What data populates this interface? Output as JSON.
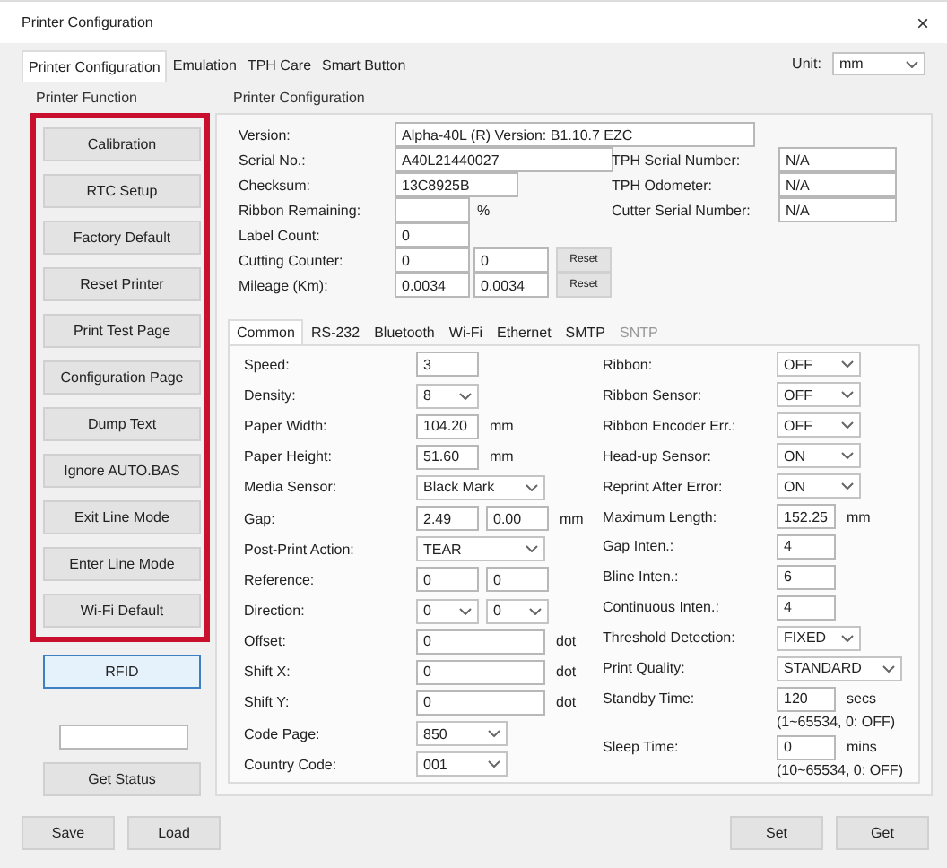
{
  "window": {
    "title": "Printer Configuration",
    "close": "×"
  },
  "tabs": [
    {
      "label": "Printer Configuration",
      "selected": true
    },
    {
      "label": "Emulation",
      "selected": false
    },
    {
      "label": "TPH Care",
      "selected": false
    },
    {
      "label": "Smart Button",
      "selected": false
    }
  ],
  "unit": {
    "label": "Unit:",
    "value": "mm"
  },
  "printer_function": {
    "title": "Printer Function",
    "highlighted_buttons": [
      {
        "label": "Calibration",
        "focused": false
      },
      {
        "label": "RTC Setup",
        "focused": false
      },
      {
        "label": "Factory Default",
        "focused": false
      },
      {
        "label": "Reset Printer",
        "focused": false
      },
      {
        "label": "Print Test Page",
        "focused": false
      },
      {
        "label": "Configuration Page",
        "focused": false
      },
      {
        "label": "Dump Text",
        "focused": false
      },
      {
        "label": "Ignore AUTO.BAS",
        "focused": false
      },
      {
        "label": "Exit Line Mode",
        "focused": false
      },
      {
        "label": "Enter Line Mode",
        "focused": false
      },
      {
        "label": "Wi-Fi Default",
        "focused": false
      }
    ],
    "buttons": [
      {
        "label": "RFID",
        "focused": true
      }
    ],
    "status_button": "Get Status"
  },
  "printer_configuration": {
    "title": "Printer Configuration",
    "rows": [
      {
        "label": "Version:",
        "fields": [
          {
            "kind": "text",
            "value": "Alpha-40L (R) Version: B1.10.7 EZC"
          }
        ]
      },
      {
        "label": "Serial No.:",
        "fields": [
          {
            "kind": "text",
            "value": "A40L21440027"
          }
        ],
        "side": {
          "label": "TPH Serial Number:",
          "value": "N/A"
        }
      },
      {
        "label": "Checksum:",
        "fields": [
          {
            "kind": "text",
            "value": "13C8925B"
          }
        ],
        "side": {
          "label": "TPH Odometer:",
          "value": "N/A"
        }
      },
      {
        "label": "Ribbon Remaining:",
        "fields": [
          {
            "kind": "text"
          }
        ],
        "unit": "%",
        "side": {
          "label": "Cutter Serial Number:",
          "value": "N/A"
        }
      },
      {
        "label": "Label Count:",
        "fields": [
          {
            "kind": "text",
            "value": "0"
          }
        ]
      },
      {
        "label": "Cutting Counter:",
        "fields": [
          {
            "kind": "text",
            "value": "0"
          },
          {
            "kind": "text",
            "value": "0"
          }
        ],
        "button": "Reset"
      },
      {
        "label": "Mileage (Km):",
        "fields": [
          {
            "kind": "text",
            "value": "0.0034"
          },
          {
            "kind": "text",
            "value": "0.0034"
          }
        ],
        "button": "Reset"
      }
    ]
  },
  "settings_tabs": [
    {
      "label": "Common",
      "selected": true,
      "disabled": false
    },
    {
      "label": "RS-232",
      "selected": false,
      "disabled": false
    },
    {
      "label": "Bluetooth",
      "selected": false,
      "disabled": false
    },
    {
      "label": "Wi-Fi",
      "selected": false,
      "disabled": false
    },
    {
      "label": "Ethernet",
      "selected": false,
      "disabled": false
    },
    {
      "label": "SMTP",
      "selected": false,
      "disabled": false
    },
    {
      "label": "SNTP",
      "selected": false,
      "disabled": true
    }
  ],
  "settings": {
    "left": [
      {
        "label": "Speed:",
        "controls": [
          {
            "kind": "text",
            "value": "3"
          }
        ]
      },
      {
        "label": "Density:",
        "controls": [
          {
            "kind": "select",
            "value": "8"
          }
        ]
      },
      {
        "label": "Paper Width:",
        "controls": [
          {
            "kind": "text",
            "value": "104.20"
          }
        ],
        "unit": "mm"
      },
      {
        "label": "Paper Height:",
        "controls": [
          {
            "kind": "text",
            "value": "51.60"
          }
        ],
        "unit": "mm"
      },
      {
        "label": "Media Sensor:",
        "controls": [
          {
            "kind": "select",
            "value": "Black Mark"
          }
        ]
      },
      {
        "label": "Gap:",
        "controls": [
          {
            "kind": "text",
            "value": "2.49"
          },
          {
            "kind": "text",
            "value": "0.00"
          }
        ],
        "unit": "mm"
      },
      {
        "label": "Post-Print Action:",
        "controls": [
          {
            "kind": "select",
            "value": "TEAR"
          }
        ]
      },
      {
        "label": "Reference:",
        "controls": [
          {
            "kind": "text",
            "value": "0"
          },
          {
            "kind": "text",
            "value": "0"
          }
        ]
      },
      {
        "label": "Direction:",
        "controls": [
          {
            "kind": "select",
            "value": "0"
          },
          {
            "kind": "select",
            "value": "0"
          }
        ]
      },
      {
        "label": "Offset:",
        "controls": [
          {
            "kind": "text",
            "value": "0"
          }
        ],
        "unit": "dot"
      },
      {
        "label": "Shift X:",
        "controls": [
          {
            "kind": "text",
            "value": "0"
          }
        ],
        "unit": "dot"
      },
      {
        "label": "Shift Y:",
        "controls": [
          {
            "kind": "text",
            "value": "0"
          }
        ],
        "unit": "dot"
      },
      {
        "label": "Code Page:",
        "controls": [
          {
            "kind": "select",
            "value": "850"
          }
        ]
      },
      {
        "label": "Country Code:",
        "controls": [
          {
            "kind": "select",
            "value": "001"
          }
        ]
      }
    ],
    "right": [
      {
        "label": "Ribbon:",
        "controls": [
          {
            "kind": "select",
            "value": "OFF"
          }
        ]
      },
      {
        "label": "Ribbon Sensor:",
        "controls": [
          {
            "kind": "select",
            "value": "OFF"
          }
        ]
      },
      {
        "label": "Ribbon Encoder Err.:",
        "controls": [
          {
            "kind": "select",
            "value": "OFF"
          }
        ]
      },
      {
        "label": "Head-up Sensor:",
        "controls": [
          {
            "kind": "select",
            "value": "ON"
          }
        ]
      },
      {
        "label": "Reprint After Error:",
        "controls": [
          {
            "kind": "select",
            "value": "ON"
          }
        ]
      },
      {
        "label": "Maximum Length:",
        "controls": [
          {
            "kind": "text",
            "value": "152.25"
          }
        ],
        "unit": "mm"
      },
      {
        "label": "Gap Inten.:",
        "controls": [
          {
            "kind": "text",
            "value": "4"
          }
        ]
      },
      {
        "label": "Bline Inten.:",
        "controls": [
          {
            "kind": "text",
            "value": "6"
          }
        ]
      },
      {
        "label": "Continuous Inten.:",
        "controls": [
          {
            "kind": "text",
            "value": "4"
          }
        ]
      },
      {
        "label": "Threshold Detection:",
        "controls": [
          {
            "kind": "select",
            "value": "FIXED"
          }
        ]
      },
      {
        "label": "Print Quality:",
        "controls": [
          {
            "kind": "select",
            "value": "STANDARD"
          }
        ]
      },
      {
        "label": "Standby Time:",
        "controls": [
          {
            "kind": "text",
            "value": "120"
          }
        ],
        "unit": "secs",
        "note": "(1~65534, 0: OFF)"
      },
      {
        "label": "Sleep Time:",
        "controls": [
          {
            "kind": "text",
            "value": "0"
          }
        ],
        "unit": "mins",
        "note": "(10~65534, 0: OFF)"
      }
    ]
  },
  "bottom_buttons": {
    "left": [
      "Save",
      "Load"
    ],
    "right": [
      "Set",
      "Get"
    ]
  }
}
